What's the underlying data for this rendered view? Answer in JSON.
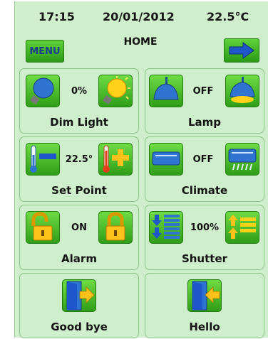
{
  "status": {
    "time": "17:15",
    "date": "20/01/2012",
    "temperature": "22.5°C"
  },
  "header": {
    "title": "HOME",
    "menu_label": "MENU"
  },
  "tiles": [
    {
      "label": "Dim Light",
      "value": "0%"
    },
    {
      "label": "Lamp",
      "value": "OFF"
    },
    {
      "label": "Set Point",
      "value": "22.5°"
    },
    {
      "label": "Climate",
      "value": "OFF"
    },
    {
      "label": "Alarm",
      "value": "ON"
    },
    {
      "label": "Shutter",
      "value": "100%"
    },
    {
      "label": "Good bye"
    },
    {
      "label": "Hello"
    }
  ],
  "icons": {
    "dim_light": [
      "bulb-off-icon",
      "bulb-on-icon"
    ],
    "lamp": [
      "lamp-off-icon",
      "lamp-on-icon"
    ],
    "set_point": [
      "thermometer-minus-icon",
      "thermometer-plus-icon"
    ],
    "climate": [
      "ac-off-icon",
      "ac-on-icon"
    ],
    "alarm": [
      "padlock-open-icon",
      "padlock-closed-icon"
    ],
    "shutter": [
      "shutter-down-icon",
      "shutter-up-icon"
    ],
    "good_bye": "exit-door-icon",
    "hello": "enter-door-icon",
    "next": "arrow-right-icon"
  },
  "colors": {
    "background": "#cfeecb",
    "button": "#3fb520",
    "button_border": "#1f7a0f",
    "menu_text": "#1a3d8c"
  }
}
